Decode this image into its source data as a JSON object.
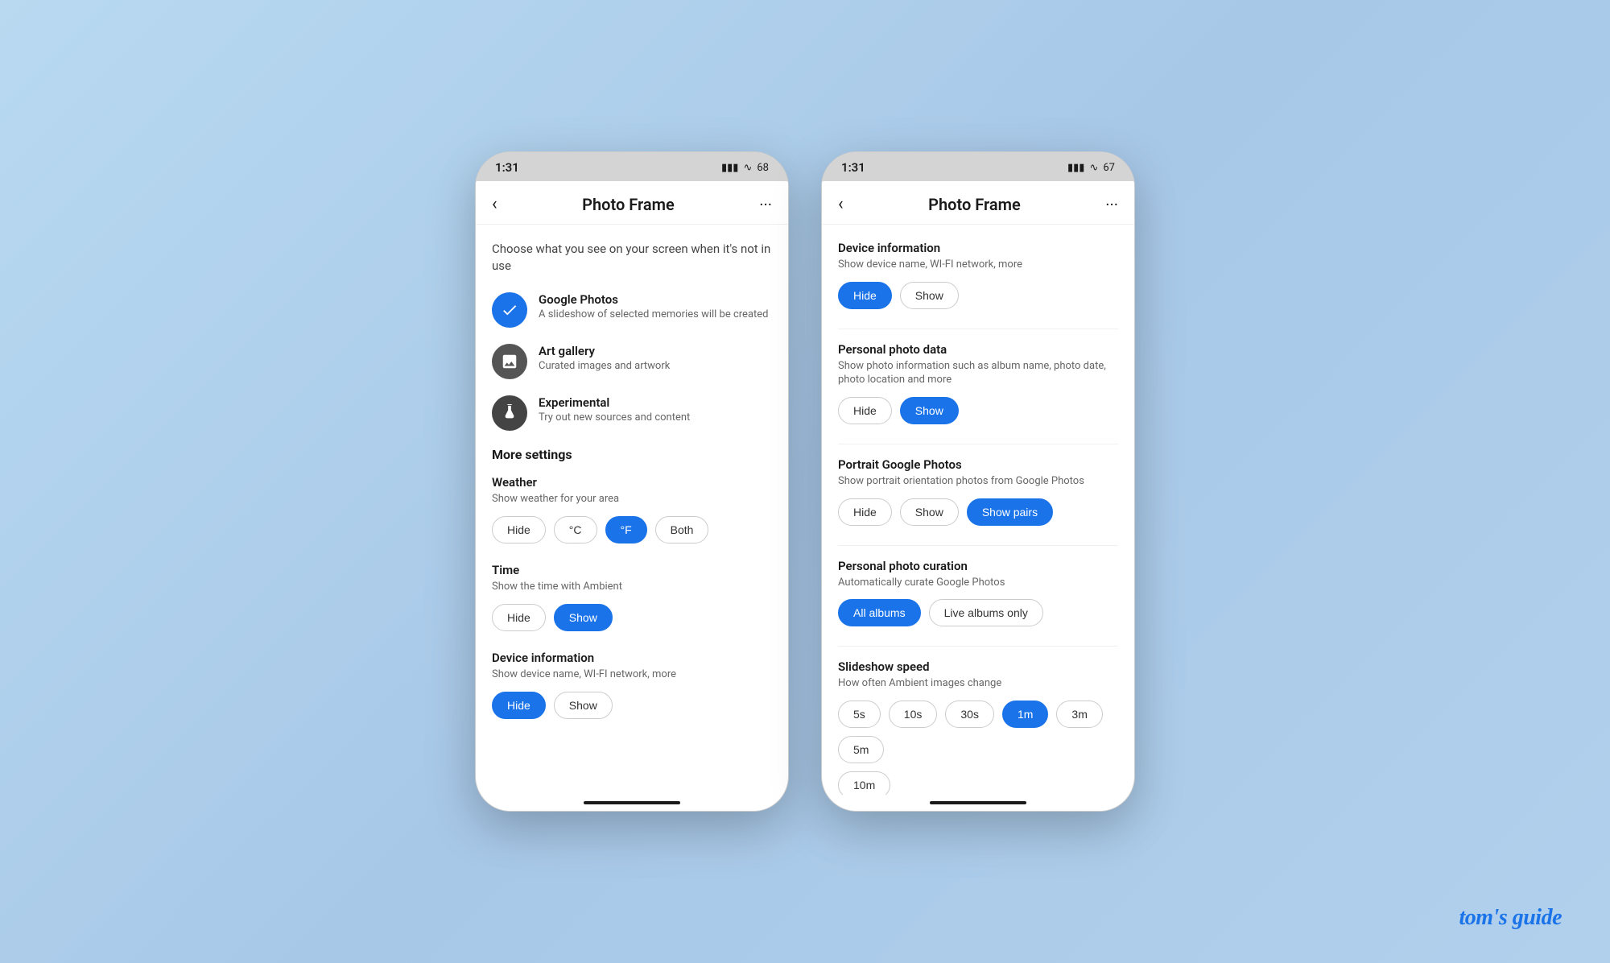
{
  "phone1": {
    "status": {
      "time": "1:31",
      "battery": "68"
    },
    "nav": {
      "back": "‹",
      "title": "Photo Frame",
      "more": "···"
    },
    "subtitle": "Choose what you see on your screen when it's not in use",
    "options": [
      {
        "id": "google-photos",
        "title": "Google Photos",
        "desc": "A slideshow of selected memories will be created",
        "iconType": "blue",
        "selected": true
      },
      {
        "id": "art-gallery",
        "title": "Art gallery",
        "desc": "Curated images and artwork",
        "iconType": "dark",
        "selected": false
      },
      {
        "id": "experimental",
        "title": "Experimental",
        "desc": "Try out new sources and content",
        "iconType": "darker",
        "selected": false
      }
    ],
    "more_settings_label": "More settings",
    "settings": [
      {
        "id": "weather",
        "label": "Weather",
        "desc": "Show weather for your area",
        "buttons": [
          {
            "label": "Hide",
            "active": false
          },
          {
            "label": "°C",
            "active": false
          },
          {
            "label": "°F",
            "active": true
          },
          {
            "label": "Both",
            "active": false
          }
        ]
      },
      {
        "id": "time",
        "label": "Time",
        "desc": "Show the time with Ambient",
        "buttons": [
          {
            "label": "Hide",
            "active": false
          },
          {
            "label": "Show",
            "active": true
          }
        ]
      },
      {
        "id": "device-info",
        "label": "Device information",
        "desc": "Show device name, WI-FI network, more",
        "buttons": [
          {
            "label": "Hide",
            "active": true
          },
          {
            "label": "Show",
            "active": false
          }
        ]
      }
    ]
  },
  "phone2": {
    "status": {
      "time": "1:31",
      "battery": "67"
    },
    "nav": {
      "back": "‹",
      "title": "Photo Frame",
      "more": "···"
    },
    "settings": [
      {
        "id": "device-info",
        "label": "Device information",
        "desc": "Show device name, WI-FI network, more",
        "buttons": [
          {
            "label": "Hide",
            "active": true
          },
          {
            "label": "Show",
            "active": false
          }
        ]
      },
      {
        "id": "personal-photo-data",
        "label": "Personal photo data",
        "desc": "Show photo information such as album name, photo date, photo location and more",
        "buttons": [
          {
            "label": "Hide",
            "active": false
          },
          {
            "label": "Show",
            "active": true
          }
        ]
      },
      {
        "id": "portrait-google-photos",
        "label": "Portrait Google Photos",
        "desc": "Show portrait orientation photos from Google Photos",
        "buttons": [
          {
            "label": "Hide",
            "active": false
          },
          {
            "label": "Show",
            "active": false
          },
          {
            "label": "Show pairs",
            "active": true
          }
        ]
      },
      {
        "id": "personal-photo-curation",
        "label": "Personal photo curation",
        "desc": "Automatically curate Google Photos",
        "buttons": [
          {
            "label": "All albums",
            "active": true
          },
          {
            "label": "Live albums only",
            "active": false
          }
        ]
      },
      {
        "id": "slideshow-speed",
        "label": "Slideshow speed",
        "desc": "How often Ambient images change",
        "buttons": [
          {
            "label": "5s",
            "active": false
          },
          {
            "label": "10s",
            "active": false
          },
          {
            "label": "30s",
            "active": false
          },
          {
            "label": "1m",
            "active": true
          },
          {
            "label": "3m",
            "active": false
          },
          {
            "label": "5m",
            "active": false
          },
          {
            "label": "10m",
            "active": false
          }
        ]
      }
    ]
  },
  "watermark": "tom's guide"
}
